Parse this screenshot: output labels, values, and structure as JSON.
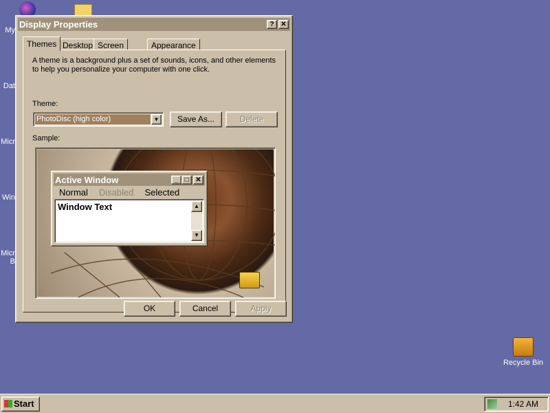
{
  "desktop": {
    "left_icons": [
      "My",
      "Dat",
      "Micr",
      "Win",
      "Micr",
      "B"
    ],
    "recycle_bin_label": "Recycle Bin"
  },
  "dialog": {
    "title": "Display Properties",
    "help_label": "?",
    "close_label": "✕",
    "tabs": [
      {
        "label": "Themes",
        "active": true
      },
      {
        "label": "Desktop"
      },
      {
        "label": "Screen Saver"
      },
      {
        "label": "Appearance"
      }
    ],
    "description": "A theme is a background plus a set of sounds, icons, and other elements to help you personalize your computer with one click.",
    "theme_label": "Theme:",
    "theme_value": "PhotoDisc (high color)",
    "save_as_label": "Save As...",
    "delete_label": "Delete",
    "sample_label": "Sample:",
    "ok_label": "OK",
    "cancel_label": "Cancel",
    "apply_label": "Apply"
  },
  "sample_window": {
    "title": "Active Window",
    "menu": {
      "normal": "Normal",
      "disabled": "Disabled",
      "selected": "Selected"
    },
    "text": "Window Text"
  },
  "taskbar": {
    "start_label": "Start",
    "clock": "1:42 AM"
  },
  "colors": {
    "desktop": "#646aa5",
    "face": "#cbbfa9",
    "title_bar": "#a0917a",
    "highlight": "#a1805d"
  }
}
